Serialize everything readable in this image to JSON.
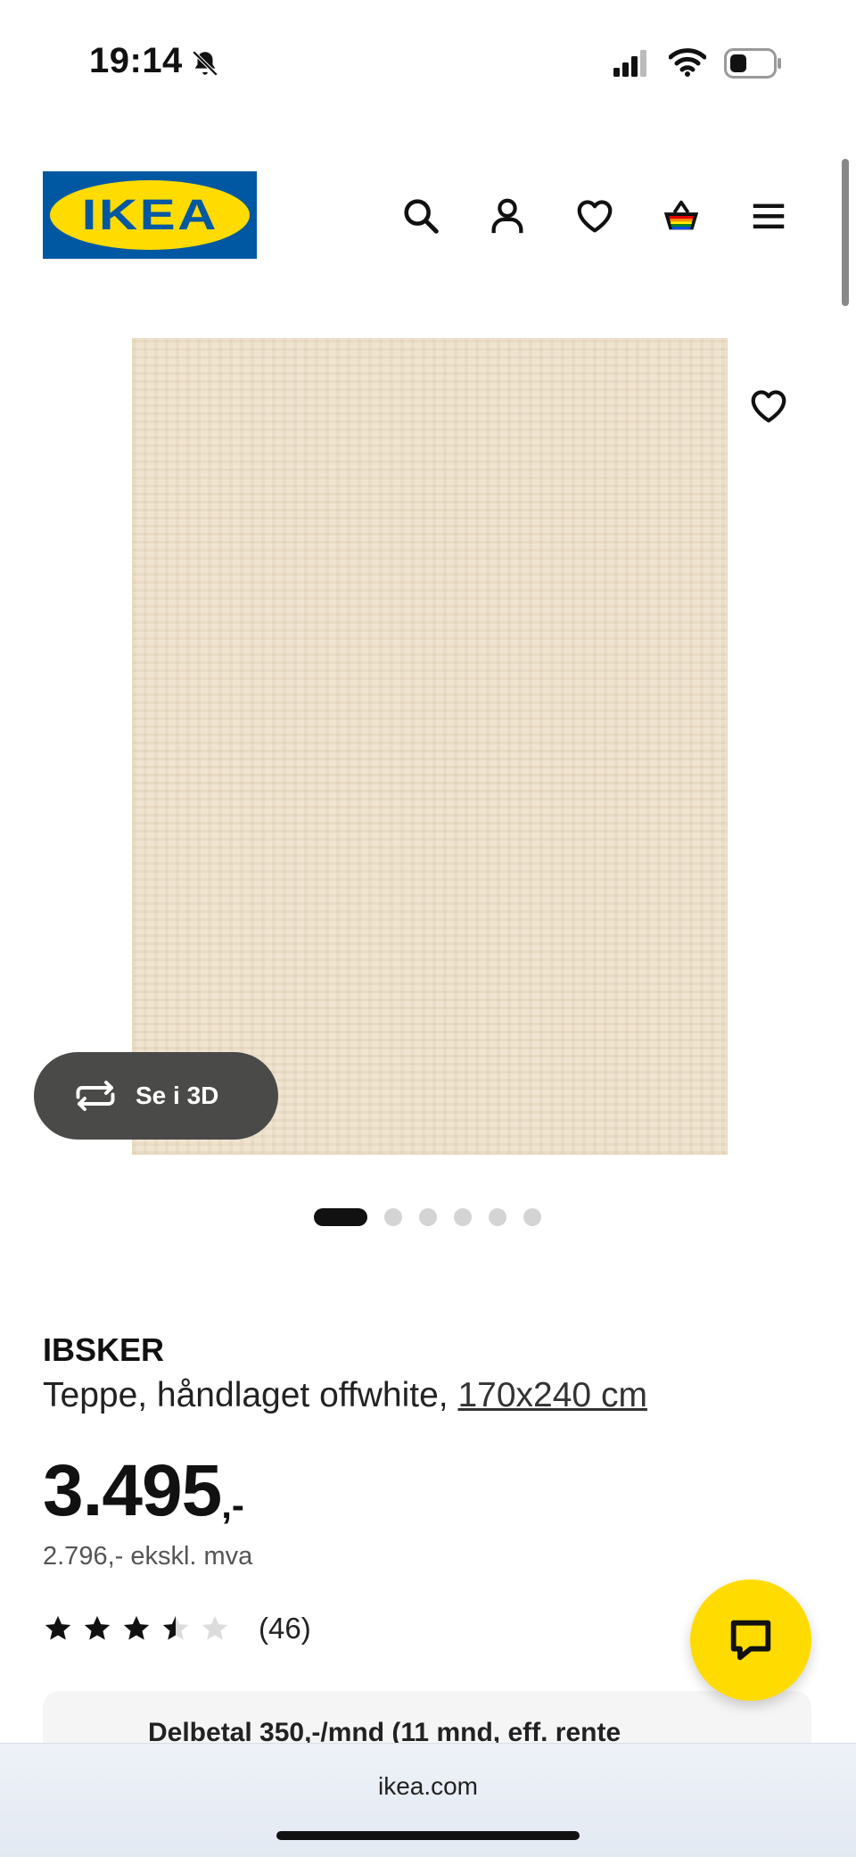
{
  "status_bar": {
    "time": "19:14"
  },
  "header": {
    "logo_text": "IKEA"
  },
  "product": {
    "see_3d_label": "Se i 3D",
    "brand": "IBSKER",
    "description": "Teppe, håndlaget offwhite, ",
    "size_link": "170x240 cm",
    "price_main": "3.495",
    "price_suffix": ",-",
    "price_ex_vat": "2.796,- ekskl. mva",
    "rating_value": 3.5,
    "rating_max": 5,
    "review_count": "(46)",
    "carousel_total": 6,
    "carousel_active": 1
  },
  "finance": {
    "text": "Delbetal 350,-/mnd (11 mnd, eff. rente"
  },
  "browser": {
    "url": "ikea.com"
  },
  "colors": {
    "ikea_blue": "#0058a3",
    "ikea_yellow": "#ffdb00",
    "rug": "#efe3cf"
  }
}
